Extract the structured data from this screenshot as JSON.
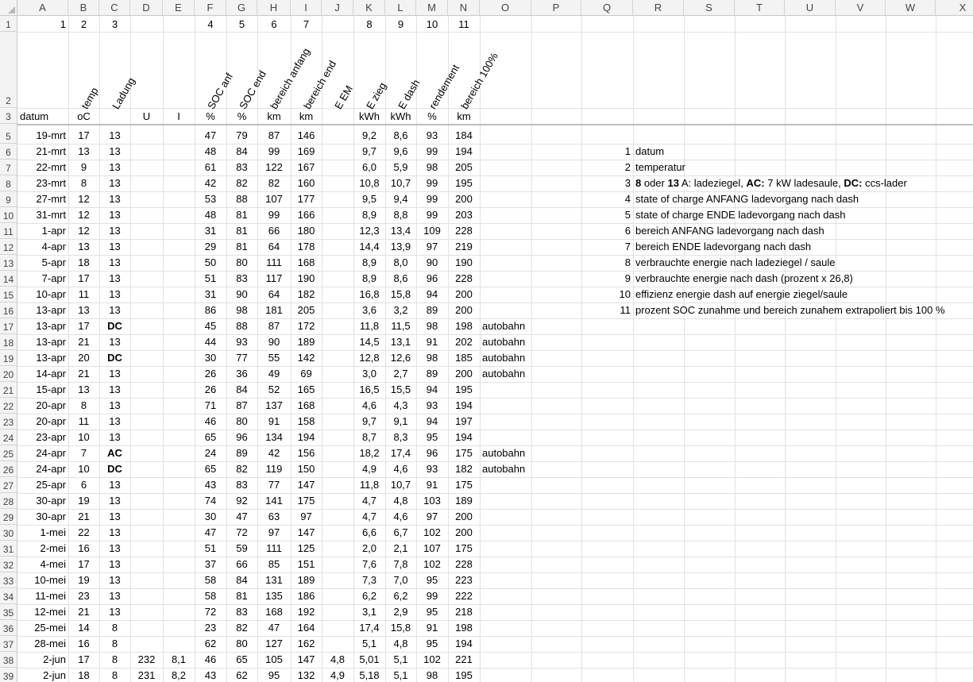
{
  "columns": [
    "A",
    "B",
    "C",
    "D",
    "E",
    "F",
    "G",
    "H",
    "I",
    "J",
    "K",
    "L",
    "M",
    "N",
    "O",
    "P",
    "Q",
    "R",
    "S",
    "T",
    "U",
    "V",
    "W",
    "X"
  ],
  "row_numbers": [
    "1",
    "2",
    "3",
    "5",
    "6",
    "7",
    "8",
    "9",
    "10",
    "11",
    "12",
    "13",
    "14",
    "15",
    "16",
    "17",
    "18",
    "19",
    "20",
    "21",
    "22",
    "23",
    "24",
    "25",
    "26",
    "27",
    "28",
    "29",
    "30",
    "31",
    "32",
    "33",
    "34",
    "35",
    "36",
    "37",
    "38",
    "39"
  ],
  "row1": {
    "A": "1",
    "B": "2",
    "C": "3",
    "F": "4",
    "G": "5",
    "H": "6",
    "I": "7",
    "K": "8",
    "L": "9",
    "M": "10",
    "N": "11"
  },
  "row2": {
    "B": "temp",
    "C": "Ladung",
    "F": "SOC anf",
    "G": "SOC end",
    "H": "bereich anfang",
    "I": "bereich end",
    "J": "E EM",
    "K": "E zieg",
    "L": "E dash",
    "M": "rendement",
    "N": "bereich 100%"
  },
  "row3": {
    "A": "datum",
    "B": "oC",
    "D": "U",
    "E": "I",
    "F": "%",
    "G": "%",
    "H": "km",
    "I": "km",
    "K": "kWh",
    "L": "kWh",
    "M": "%",
    "N": "km"
  },
  "rows": [
    {
      "A": "19-mrt",
      "B": "17",
      "C": "13",
      "D": "",
      "E": "",
      "F": "47",
      "G": "79",
      "H": "87",
      "I": "146",
      "J": "",
      "K": "9,2",
      "L": "8,6",
      "M": "93",
      "N": "184",
      "O": "",
      "bold": false
    },
    {
      "A": "21-mrt",
      "B": "13",
      "C": "13",
      "D": "",
      "E": "",
      "F": "48",
      "G": "84",
      "H": "99",
      "I": "169",
      "J": "",
      "K": "9,7",
      "L": "9,6",
      "M": "99",
      "N": "194",
      "O": "",
      "bold": false
    },
    {
      "A": "22-mrt",
      "B": "9",
      "C": "13",
      "D": "",
      "E": "",
      "F": "61",
      "G": "83",
      "H": "122",
      "I": "167",
      "J": "",
      "K": "6,0",
      "L": "5,9",
      "M": "98",
      "N": "205",
      "O": "",
      "bold": false
    },
    {
      "A": "23-mrt",
      "B": "8",
      "C": "13",
      "D": "",
      "E": "",
      "F": "42",
      "G": "82",
      "H": "82",
      "I": "160",
      "J": "",
      "K": "10,8",
      "L": "10,7",
      "M": "99",
      "N": "195",
      "O": "",
      "bold": false
    },
    {
      "A": "27-mrt",
      "B": "12",
      "C": "13",
      "D": "",
      "E": "",
      "F": "53",
      "G": "88",
      "H": "107",
      "I": "177",
      "J": "",
      "K": "9,5",
      "L": "9,4",
      "M": "99",
      "N": "200",
      "O": "",
      "bold": false
    },
    {
      "A": "31-mrt",
      "B": "12",
      "C": "13",
      "D": "",
      "E": "",
      "F": "48",
      "G": "81",
      "H": "99",
      "I": "166",
      "J": "",
      "K": "8,9",
      "L": "8,8",
      "M": "99",
      "N": "203",
      "O": "",
      "bold": false
    },
    {
      "A": "1-apr",
      "B": "12",
      "C": "13",
      "D": "",
      "E": "",
      "F": "31",
      "G": "81",
      "H": "66",
      "I": "180",
      "J": "",
      "K": "12,3",
      "L": "13,4",
      "M": "109",
      "N": "228",
      "O": "",
      "bold": false
    },
    {
      "A": "4-apr",
      "B": "13",
      "C": "13",
      "D": "",
      "E": "",
      "F": "29",
      "G": "81",
      "H": "64",
      "I": "178",
      "J": "",
      "K": "14,4",
      "L": "13,9",
      "M": "97",
      "N": "219",
      "O": "",
      "bold": false
    },
    {
      "A": "5-apr",
      "B": "18",
      "C": "13",
      "D": "",
      "E": "",
      "F": "50",
      "G": "80",
      "H": "111",
      "I": "168",
      "J": "",
      "K": "8,9",
      "L": "8,0",
      "M": "90",
      "N": "190",
      "O": "",
      "bold": false
    },
    {
      "A": "7-apr",
      "B": "17",
      "C": "13",
      "D": "",
      "E": "",
      "F": "51",
      "G": "83",
      "H": "117",
      "I": "190",
      "J": "",
      "K": "8,9",
      "L": "8,6",
      "M": "96",
      "N": "228",
      "O": "",
      "bold": false
    },
    {
      "A": "10-apr",
      "B": "11",
      "C": "13",
      "D": "",
      "E": "",
      "F": "31",
      "G": "90",
      "H": "64",
      "I": "182",
      "J": "",
      "K": "16,8",
      "L": "15,8",
      "M": "94",
      "N": "200",
      "O": "",
      "bold": false
    },
    {
      "A": "13-apr",
      "B": "13",
      "C": "13",
      "D": "",
      "E": "",
      "F": "86",
      "G": "98",
      "H": "181",
      "I": "205",
      "J": "",
      "K": "3,6",
      "L": "3,2",
      "M": "89",
      "N": "200",
      "O": "",
      "bold": false
    },
    {
      "A": "13-apr",
      "B": "17",
      "C": "DC",
      "D": "",
      "E": "",
      "F": "45",
      "G": "88",
      "H": "87",
      "I": "172",
      "J": "",
      "K": "11,8",
      "L": "11,5",
      "M": "98",
      "N": "198",
      "O": "autobahn",
      "bold": true
    },
    {
      "A": "13-apr",
      "B": "21",
      "C": "13",
      "D": "",
      "E": "",
      "F": "44",
      "G": "93",
      "H": "90",
      "I": "189",
      "J": "",
      "K": "14,5",
      "L": "13,1",
      "M": "91",
      "N": "202",
      "O": "autobahn",
      "bold": false
    },
    {
      "A": "13-apr",
      "B": "20",
      "C": "DC",
      "D": "",
      "E": "",
      "F": "30",
      "G": "77",
      "H": "55",
      "I": "142",
      "J": "",
      "K": "12,8",
      "L": "12,6",
      "M": "98",
      "N": "185",
      "O": "autobahn",
      "bold": true
    },
    {
      "A": "14-apr",
      "B": "21",
      "C": "13",
      "D": "",
      "E": "",
      "F": "26",
      "G": "36",
      "H": "49",
      "I": "69",
      "J": "",
      "K": "3,0",
      "L": "2,7",
      "M": "89",
      "N": "200",
      "O": "autobahn",
      "bold": false
    },
    {
      "A": "15-apr",
      "B": "13",
      "C": "13",
      "D": "",
      "E": "",
      "F": "26",
      "G": "84",
      "H": "52",
      "I": "165",
      "J": "",
      "K": "16,5",
      "L": "15,5",
      "M": "94",
      "N": "195",
      "O": "",
      "bold": false
    },
    {
      "A": "20-apr",
      "B": "8",
      "C": "13",
      "D": "",
      "E": "",
      "F": "71",
      "G": "87",
      "H": "137",
      "I": "168",
      "J": "",
      "K": "4,6",
      "L": "4,3",
      "M": "93",
      "N": "194",
      "O": "",
      "bold": false
    },
    {
      "A": "20-apr",
      "B": "11",
      "C": "13",
      "D": "",
      "E": "",
      "F": "46",
      "G": "80",
      "H": "91",
      "I": "158",
      "J": "",
      "K": "9,7",
      "L": "9,1",
      "M": "94",
      "N": "197",
      "O": "",
      "bold": false
    },
    {
      "A": "23-apr",
      "B": "10",
      "C": "13",
      "D": "",
      "E": "",
      "F": "65",
      "G": "96",
      "H": "134",
      "I": "194",
      "J": "",
      "K": "8,7",
      "L": "8,3",
      "M": "95",
      "N": "194",
      "O": "",
      "bold": false
    },
    {
      "A": "24-apr",
      "B": "7",
      "C": "AC",
      "D": "",
      "E": "",
      "F": "24",
      "G": "89",
      "H": "42",
      "I": "156",
      "J": "",
      "K": "18,2",
      "L": "17,4",
      "M": "96",
      "N": "175",
      "O": "autobahn",
      "bold": true
    },
    {
      "A": "24-apr",
      "B": "10",
      "C": "DC",
      "D": "",
      "E": "",
      "F": "65",
      "G": "82",
      "H": "119",
      "I": "150",
      "J": "",
      "K": "4,9",
      "L": "4,6",
      "M": "93",
      "N": "182",
      "O": "autobahn",
      "bold": true
    },
    {
      "A": "25-apr",
      "B": "6",
      "C": "13",
      "D": "",
      "E": "",
      "F": "43",
      "G": "83",
      "H": "77",
      "I": "147",
      "J": "",
      "K": "11,8",
      "L": "10,7",
      "M": "91",
      "N": "175",
      "O": "",
      "bold": false
    },
    {
      "A": "30-apr",
      "B": "19",
      "C": "13",
      "D": "",
      "E": "",
      "F": "74",
      "G": "92",
      "H": "141",
      "I": "175",
      "J": "",
      "K": "4,7",
      "L": "4,8",
      "M": "103",
      "N": "189",
      "O": "",
      "bold": false
    },
    {
      "A": "30-apr",
      "B": "21",
      "C": "13",
      "D": "",
      "E": "",
      "F": "30",
      "G": "47",
      "H": "63",
      "I": "97",
      "J": "",
      "K": "4,7",
      "L": "4,6",
      "M": "97",
      "N": "200",
      "O": "",
      "bold": false
    },
    {
      "A": "1-mei",
      "B": "22",
      "C": "13",
      "D": "",
      "E": "",
      "F": "47",
      "G": "72",
      "H": "97",
      "I": "147",
      "J": "",
      "K": "6,6",
      "L": "6,7",
      "M": "102",
      "N": "200",
      "O": "",
      "bold": false
    },
    {
      "A": "2-mei",
      "B": "16",
      "C": "13",
      "D": "",
      "E": "",
      "F": "51",
      "G": "59",
      "H": "111",
      "I": "125",
      "J": "",
      "K": "2,0",
      "L": "2,1",
      "M": "107",
      "N": "175",
      "O": "",
      "bold": false
    },
    {
      "A": "4-mei",
      "B": "17",
      "C": "13",
      "D": "",
      "E": "",
      "F": "37",
      "G": "66",
      "H": "85",
      "I": "151",
      "J": "",
      "K": "7,6",
      "L": "7,8",
      "M": "102",
      "N": "228",
      "O": "",
      "bold": false
    },
    {
      "A": "10-mei",
      "B": "19",
      "C": "13",
      "D": "",
      "E": "",
      "F": "58",
      "G": "84",
      "H": "131",
      "I": "189",
      "J": "",
      "K": "7,3",
      "L": "7,0",
      "M": "95",
      "N": "223",
      "O": "",
      "bold": false
    },
    {
      "A": "11-mei",
      "B": "23",
      "C": "13",
      "D": "",
      "E": "",
      "F": "58",
      "G": "81",
      "H": "135",
      "I": "186",
      "J": "",
      "K": "6,2",
      "L": "6,2",
      "M": "99",
      "N": "222",
      "O": "",
      "bold": false
    },
    {
      "A": "12-mei",
      "B": "21",
      "C": "13",
      "D": "",
      "E": "",
      "F": "72",
      "G": "83",
      "H": "168",
      "I": "192",
      "J": "",
      "K": "3,1",
      "L": "2,9",
      "M": "95",
      "N": "218",
      "O": "",
      "bold": false
    },
    {
      "A": "25-mei",
      "B": "14",
      "C": "8",
      "D": "",
      "E": "",
      "F": "23",
      "G": "82",
      "H": "47",
      "I": "164",
      "J": "",
      "K": "17,4",
      "L": "15,8",
      "M": "91",
      "N": "198",
      "O": "",
      "bold": false
    },
    {
      "A": "28-mei",
      "B": "16",
      "C": "8",
      "D": "",
      "E": "",
      "F": "62",
      "G": "80",
      "H": "127",
      "I": "162",
      "J": "",
      "K": "5,1",
      "L": "4,8",
      "M": "95",
      "N": "194",
      "O": "",
      "bold": false
    },
    {
      "A": "2-jun",
      "B": "17",
      "C": "8",
      "D": "232",
      "E": "8,1",
      "F": "46",
      "G": "65",
      "H": "105",
      "I": "147",
      "J": "4,8",
      "K": "5,01",
      "L": "5,1",
      "M": "102",
      "N": "221",
      "O": "",
      "bold": false
    },
    {
      "A": "2-jun",
      "B": "18",
      "C": "8",
      "D": "231",
      "E": "8,2",
      "F": "43",
      "G": "62",
      "H": "95",
      "I": "132",
      "J": "4,9",
      "K": "5,18",
      "L": "5,1",
      "M": "98",
      "N": "195",
      "O": "",
      "bold": false
    }
  ],
  "legend": [
    {
      "num": "1",
      "parts": [
        {
          "t": "datum",
          "b": false
        }
      ]
    },
    {
      "num": "2",
      "parts": [
        {
          "t": "temperatur",
          "b": false
        }
      ]
    },
    {
      "num": "3",
      "parts": [
        {
          "t": "8",
          "b": true
        },
        {
          "t": " oder ",
          "b": false
        },
        {
          "t": "13",
          "b": true
        },
        {
          "t": " A:  ladeziegel, ",
          "b": false
        },
        {
          "t": "AC:",
          "b": true
        },
        {
          "t": " 7 kW ladesaule, ",
          "b": false
        },
        {
          "t": "DC:",
          "b": true
        },
        {
          "t": " ccs-lader",
          "b": false
        }
      ]
    },
    {
      "num": "4",
      "parts": [
        {
          "t": "state of charge ANFANG ladevorgang nach dash",
          "b": false
        }
      ]
    },
    {
      "num": "5",
      "parts": [
        {
          "t": "state of charge ENDE ladevorgang nach dash",
          "b": false
        }
      ]
    },
    {
      "num": "6",
      "parts": [
        {
          "t": "bereich ANFANG ladevorgang nach dash",
          "b": false
        }
      ]
    },
    {
      "num": "7",
      "parts": [
        {
          "t": "bereich ENDE  ladevorgang nach dash",
          "b": false
        }
      ]
    },
    {
      "num": "8",
      "parts": [
        {
          "t": "verbrauchte energie nach ladeziegel / saule",
          "b": false
        }
      ]
    },
    {
      "num": "9",
      "parts": [
        {
          "t": "verbrauchte energie nach dash (prozent x 26,8)",
          "b": false
        }
      ]
    },
    {
      "num": "10",
      "parts": [
        {
          "t": "effizienz  energie dash auf energie ziegel/saule",
          "b": false
        }
      ]
    },
    {
      "num": "11",
      "parts": [
        {
          "t": "prozent SOC zunahme und bereich zunahem extrapoliert bis 100 %",
          "b": false
        }
      ]
    }
  ]
}
